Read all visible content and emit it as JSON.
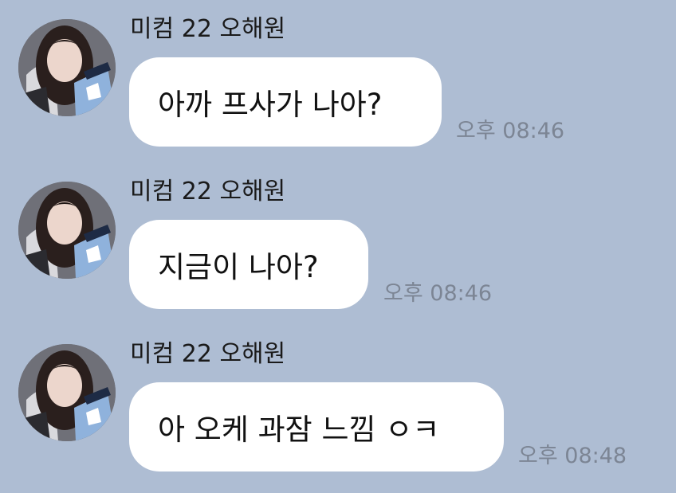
{
  "chat": {
    "messages": [
      {
        "sender": "미컴 22 오해원",
        "text": "아까 프사가 나아?",
        "time": "오후 08:46",
        "avatar_icon": "profile-photo-icon"
      },
      {
        "sender": "미컴 22 오해원",
        "text": "지금이 나아?",
        "time": "오후 08:46",
        "avatar_icon": "profile-photo-icon"
      },
      {
        "sender": "미컴 22 오해원",
        "text": "아 오케 과잠 느낌 ㅇㅋ",
        "time": "오후 08:48",
        "avatar_icon": "profile-photo-icon"
      }
    ]
  },
  "colors": {
    "background": "#aebdd3",
    "bubble": "#ffffff",
    "time_text": "#7c8594"
  }
}
